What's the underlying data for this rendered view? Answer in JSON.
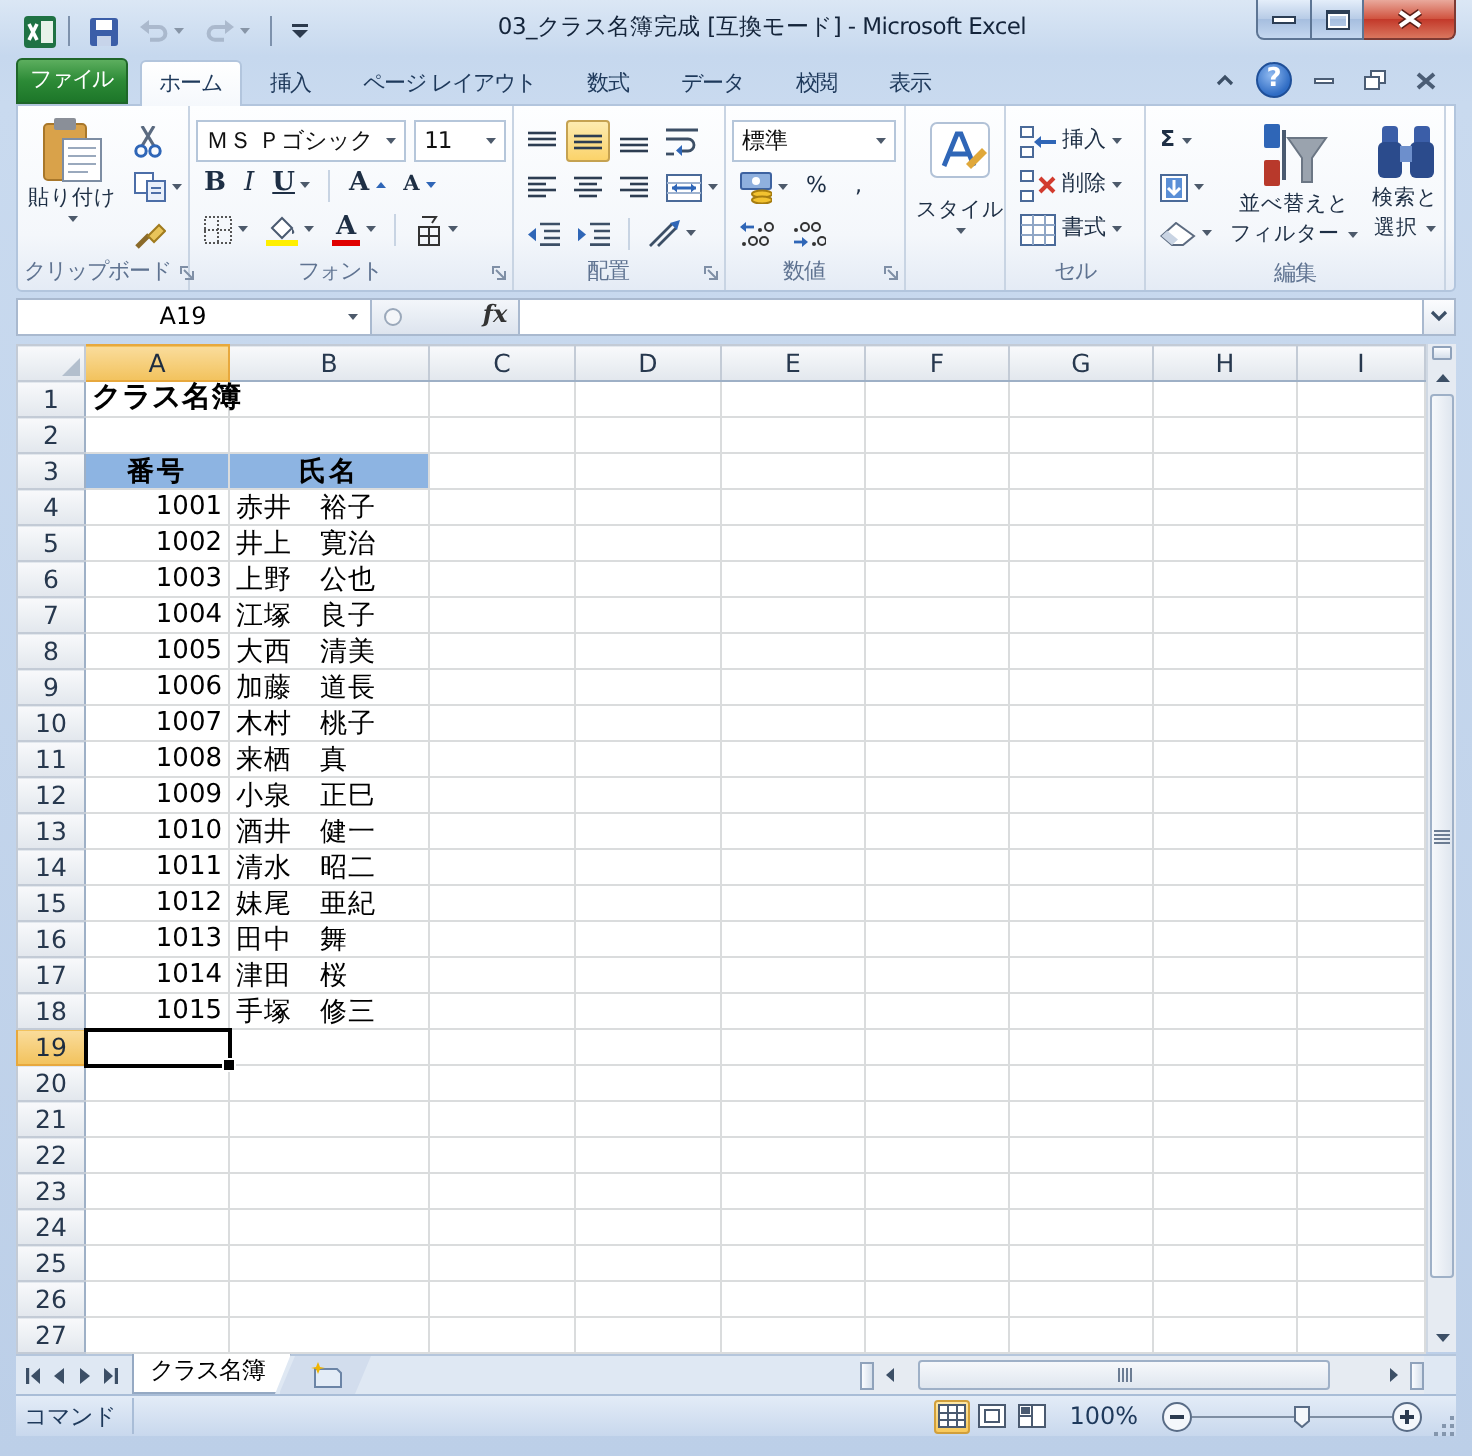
{
  "window": {
    "title": "03_クラス名簿完成 [互換モード] - Microsoft Excel"
  },
  "quick_access": [
    {
      "kind": "save",
      "disabled": false
    },
    {
      "kind": "undo",
      "disabled": true
    },
    {
      "kind": "redo",
      "disabled": true
    }
  ],
  "ribbon_tabs": [
    {
      "label": "ファイル",
      "kind": "file",
      "selected": false
    },
    {
      "label": "ホーム",
      "kind": "tab",
      "selected": true
    },
    {
      "label": "挿入",
      "kind": "tab",
      "selected": false
    },
    {
      "label": "ページ レイアウト",
      "kind": "tab",
      "selected": false
    },
    {
      "label": "数式",
      "kind": "tab",
      "selected": false
    },
    {
      "label": "データ",
      "kind": "tab",
      "selected": false
    },
    {
      "label": "校閲",
      "kind": "tab",
      "selected": false
    },
    {
      "label": "表示",
      "kind": "tab",
      "selected": false
    }
  ],
  "help_button": "?",
  "clipboard_group": {
    "label": "クリップボード",
    "paste": "貼り付け"
  },
  "font_group": {
    "label": "フォント",
    "font_name": "ＭＳ Ｐゴシック",
    "font_size": "11",
    "bold": "B",
    "italic": "I",
    "underline": "U",
    "grow": "A",
    "shrink": "A",
    "font_color": "A"
  },
  "alignment_group": {
    "label": "配置",
    "vertical": [
      {
        "selected": false
      },
      {
        "selected": true
      },
      {
        "selected": false
      }
    ],
    "horizontal": [
      {
        "selected": false
      },
      {
        "selected": false
      },
      {
        "selected": false
      }
    ]
  },
  "number_group": {
    "label": "数値",
    "format": "標準",
    "percent": "%",
    "comma": ","
  },
  "styles_group": {
    "button": "スタイル"
  },
  "cells_group": {
    "label": "セル",
    "items": [
      {
        "kind": "insert",
        "label": "挿入"
      },
      {
        "kind": "delete",
        "label": "削除"
      },
      {
        "kind": "format",
        "label": "書式"
      }
    ]
  },
  "editing_group": {
    "label": "編集",
    "sum": "Σ",
    "sort_filter": [
      "並べ替えと",
      "フィルター"
    ],
    "find_select": [
      "検索と",
      "選択"
    ]
  },
  "formula_bar": {
    "name_box": "A19",
    "fx": "fx"
  },
  "sheet": {
    "columns": [
      {
        "label": "A",
        "selected": true
      },
      {
        "label": "B",
        "selected": false
      },
      {
        "label": "C",
        "selected": false
      },
      {
        "label": "D",
        "selected": false
      },
      {
        "label": "E",
        "selected": false
      },
      {
        "label": "F",
        "selected": false
      },
      {
        "label": "G",
        "selected": false
      },
      {
        "label": "H",
        "selected": false
      },
      {
        "label": "I",
        "selected": false
      }
    ],
    "rows": [
      {
        "label": "1",
        "selected": false,
        "kind": "title",
        "cells": [
          "クラス名簿"
        ]
      },
      {
        "label": "2",
        "selected": false,
        "kind": "blank"
      },
      {
        "label": "3",
        "selected": false,
        "kind": "header",
        "cells": [
          "番号",
          "氏名"
        ]
      },
      {
        "label": "4",
        "selected": false,
        "kind": "data",
        "cells": [
          "1001",
          "赤井　裕子"
        ]
      },
      {
        "label": "5",
        "selected": false,
        "kind": "data",
        "cells": [
          "1002",
          "井上　寛治"
        ]
      },
      {
        "label": "6",
        "selected": false,
        "kind": "data",
        "cells": [
          "1003",
          "上野　公也"
        ]
      },
      {
        "label": "7",
        "selected": false,
        "kind": "data",
        "cells": [
          "1004",
          "江塚　良子"
        ]
      },
      {
        "label": "8",
        "selected": false,
        "kind": "data",
        "cells": [
          "1005",
          "大西　清美"
        ]
      },
      {
        "label": "9",
        "selected": false,
        "kind": "data",
        "cells": [
          "1006",
          "加藤　道長"
        ]
      },
      {
        "label": "10",
        "selected": false,
        "kind": "data",
        "cells": [
          "1007",
          "木村　桃子"
        ]
      },
      {
        "label": "11",
        "selected": false,
        "kind": "data",
        "cells": [
          "1008",
          "来栖　真"
        ]
      },
      {
        "label": "12",
        "selected": false,
        "kind": "data",
        "cells": [
          "1009",
          "小泉　正巳"
        ]
      },
      {
        "label": "13",
        "selected": false,
        "kind": "data",
        "cells": [
          "1010",
          "酒井　健一"
        ]
      },
      {
        "label": "14",
        "selected": false,
        "kind": "data",
        "cells": [
          "1011",
          "清水　昭二"
        ]
      },
      {
        "label": "15",
        "selected": false,
        "kind": "data",
        "cells": [
          "1012",
          "妹尾　亜紀"
        ]
      },
      {
        "label": "16",
        "selected": false,
        "kind": "data",
        "cells": [
          "1013",
          "田中　舞"
        ]
      },
      {
        "label": "17",
        "selected": false,
        "kind": "data",
        "cells": [
          "1014",
          "津田　桜"
        ]
      },
      {
        "label": "18",
        "selected": false,
        "kind": "data",
        "cells": [
          "1015",
          "手塚　修三"
        ]
      },
      {
        "label": "19",
        "selected": true,
        "kind": "blank"
      },
      {
        "label": "20",
        "selected": false,
        "kind": "blank"
      },
      {
        "label": "21",
        "selected": false,
        "kind": "blank"
      },
      {
        "label": "22",
        "selected": false,
        "kind": "blank"
      },
      {
        "label": "23",
        "selected": false,
        "kind": "blank"
      },
      {
        "label": "24",
        "selected": false,
        "kind": "blank"
      },
      {
        "label": "25",
        "selected": false,
        "kind": "blank"
      },
      {
        "label": "26",
        "selected": false,
        "kind": "blank"
      },
      {
        "label": "27",
        "selected": false,
        "kind": "blank"
      }
    ]
  },
  "sheet_tabs": [
    {
      "label": "クラス名簿",
      "selected": true
    }
  ],
  "status_bar": {
    "mode": "コマンド",
    "views": [
      {
        "kind": "normal",
        "selected": true
      },
      {
        "kind": "page_layout",
        "selected": false
      },
      {
        "kind": "page_break",
        "selected": false
      }
    ],
    "zoom": "100%",
    "zoom_slider": {
      "level": 0.55
    }
  }
}
